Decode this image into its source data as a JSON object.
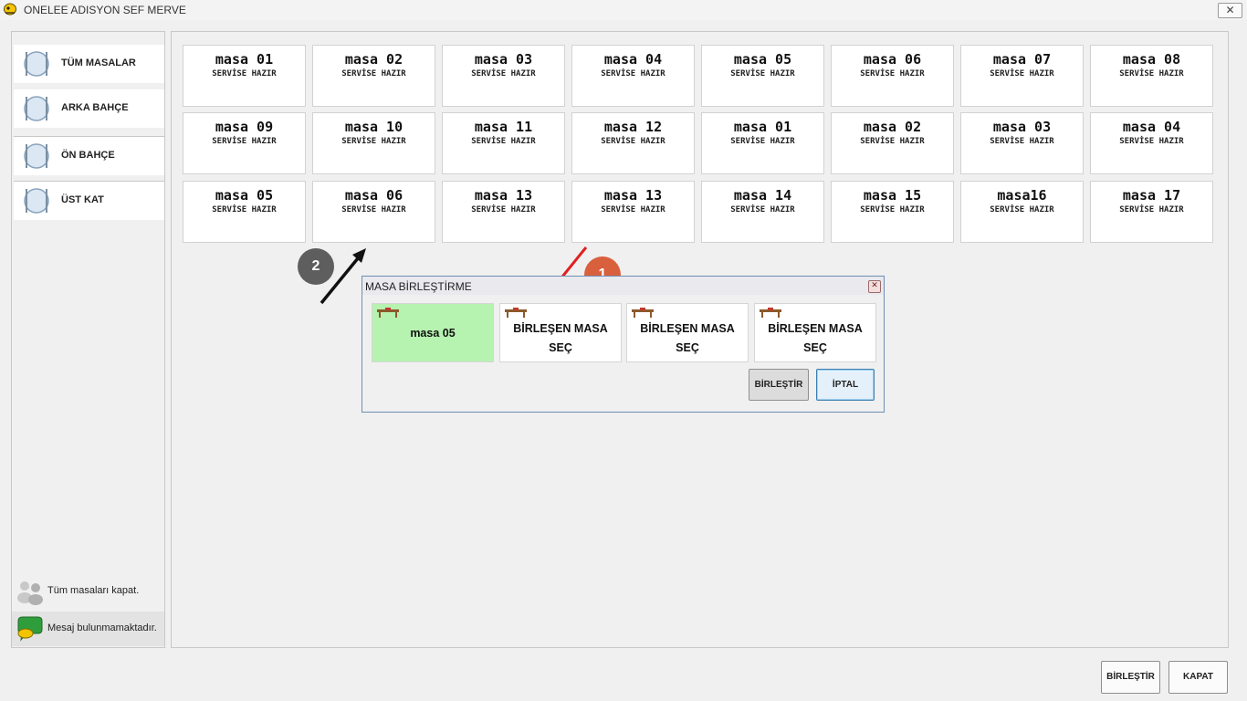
{
  "window": {
    "title": "ONELEE ADISYON SEF MERVE",
    "close_glyph": "✕"
  },
  "sidebar": {
    "items": [
      {
        "label": "TÜM MASALAR",
        "icon": "cutlery-icon"
      },
      {
        "label": "ARKA BAHÇE",
        "icon": "cutlery-icon"
      },
      {
        "label": "ÖN BAHÇE",
        "icon": "cutlery-icon"
      },
      {
        "label": "ÜST KAT",
        "icon": "cutlery-icon"
      }
    ],
    "close_all": "Tüm masaları kapat.",
    "messages": "Mesaj bulunmamaktadır."
  },
  "tables": [
    {
      "name": "masa 01",
      "status": "SERVİSE HAZIR"
    },
    {
      "name": "masa 02",
      "status": "SERVİSE HAZIR"
    },
    {
      "name": "masa 03",
      "status": "SERVİSE HAZIR"
    },
    {
      "name": "masa 04",
      "status": "SERVİSE HAZIR"
    },
    {
      "name": "masa 05",
      "status": "SERVİSE HAZIR"
    },
    {
      "name": "masa 06",
      "status": "SERVİSE HAZIR"
    },
    {
      "name": "masa 07",
      "status": "SERVİSE HAZIR"
    },
    {
      "name": "masa 08",
      "status": "SERVİSE HAZIR"
    },
    {
      "name": "masa 09",
      "status": "SERVİSE HAZIR"
    },
    {
      "name": "masa 10",
      "status": "SERVİSE HAZIR"
    },
    {
      "name": "masa 11",
      "status": "SERVİSE HAZIR"
    },
    {
      "name": "masa 12",
      "status": "SERVİSE HAZIR"
    },
    {
      "name": "masa 01",
      "status": "SERVİSE HAZIR"
    },
    {
      "name": "masa 02",
      "status": "SERVİSE HAZIR"
    },
    {
      "name": "masa 03",
      "status": "SERVİSE HAZIR"
    },
    {
      "name": "masa 04",
      "status": "SERVİSE HAZIR"
    },
    {
      "name": "masa 05",
      "status": "SERVİSE HAZIR"
    },
    {
      "name": "masa 06",
      "status": "SERVİSE HAZIR"
    },
    {
      "name": "masa 13",
      "status": "SERVİSE HAZIR"
    },
    {
      "name": "masa 13",
      "status": "SERVİSE HAZIR"
    },
    {
      "name": "masa 14",
      "status": "SERVİSE HAZIR"
    },
    {
      "name": "masa 15",
      "status": "SERVİSE HAZIR"
    },
    {
      "name": "masa16",
      "status": "SERVİSE HAZIR"
    },
    {
      "name": "masa 17",
      "status": "SERVİSE HAZIR"
    }
  ],
  "annotations": {
    "badge_1": "1",
    "badge_2": "2",
    "arrow_1_color": "#e02020",
    "arrow_2_color": "#111111"
  },
  "dialog": {
    "title": "MASA BİRLEŞTİRME",
    "close_glyph": "✕",
    "slots": [
      {
        "line1": "masa 05",
        "line2": ""
      },
      {
        "line1": "BİRLEŞEN MASA",
        "line2": "SEÇ"
      },
      {
        "line1": "BİRLEŞEN MASA",
        "line2": "SEÇ"
      },
      {
        "line1": "BİRLEŞEN MASA",
        "line2": "SEÇ"
      }
    ],
    "merge_label": "BİRLEŞTİR",
    "cancel_label": "İPTAL"
  },
  "footer": {
    "merge_label": "BİRLEŞTİR",
    "close_label": "KAPAT"
  },
  "colors": {
    "selected_slot": "#b6f2b0",
    "badge_orange": "#d9603d",
    "badge_gray": "#5e5e5e"
  }
}
